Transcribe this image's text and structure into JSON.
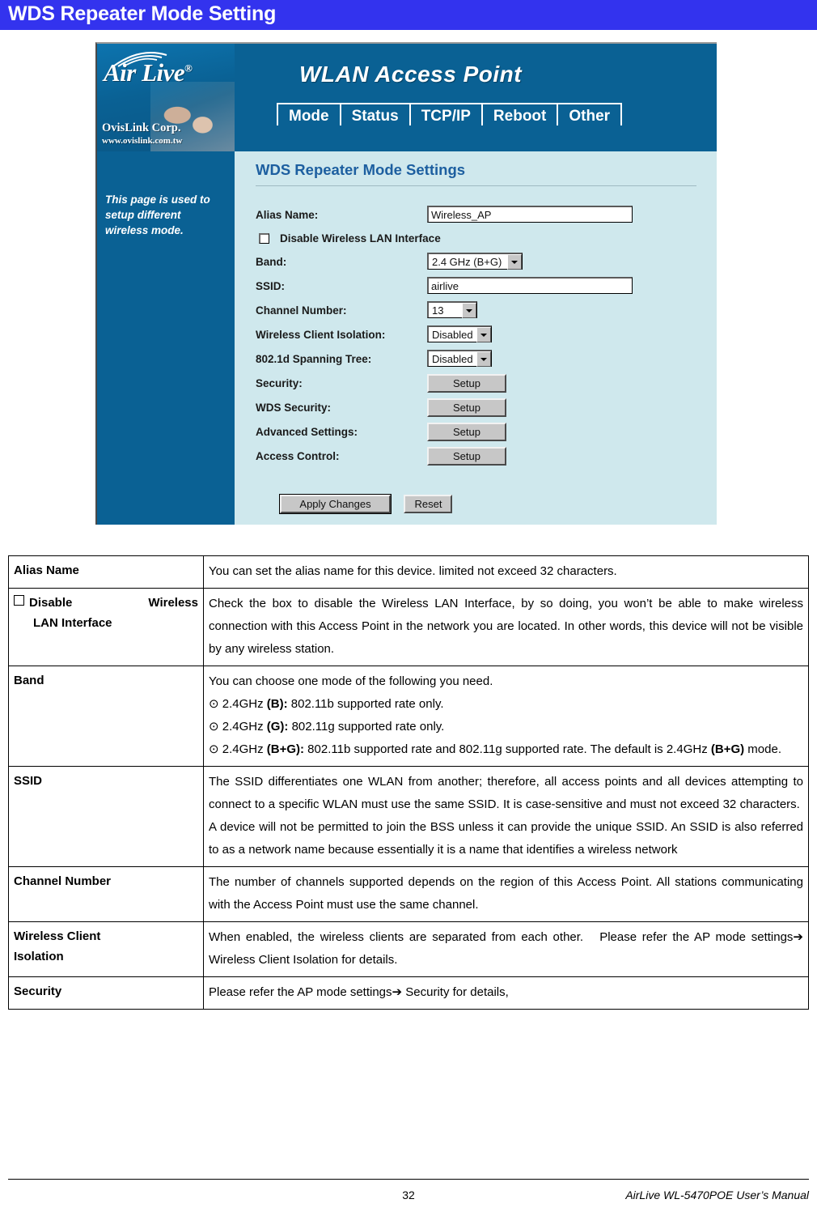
{
  "page_header": {
    "title": "WDS Repeater Mode Setting",
    "bar_color": "#3333EE"
  },
  "screenshot": {
    "banner": {
      "brand_logo": "Air Live",
      "brand_registered": "®",
      "brand_corp": "OvisLink Corp.",
      "brand_url": "www.ovislink.com.tw",
      "product_title": "WLAN Access Point",
      "banner_color": "#0A6194",
      "tabs": [
        {
          "label": "Mode"
        },
        {
          "label": "Status"
        },
        {
          "label": "TCP/IP"
        },
        {
          "label": "Reboot"
        },
        {
          "label": "Other"
        }
      ]
    },
    "sidebar": {
      "help_text": "This page is used to setup different wireless mode."
    },
    "content": {
      "title": "WDS Repeater Mode Settings",
      "title_color": "#1D5FA0",
      "background_color": "#CFE8ED",
      "fields": {
        "alias_name": {
          "label": "Alias Name:",
          "value": "Wireless_AP"
        },
        "disable_wlan": {
          "label": "Disable Wireless LAN Interface",
          "checked": false
        },
        "band": {
          "label": "Band:",
          "value": "2.4 GHz (B+G)"
        },
        "ssid": {
          "label": "SSID:",
          "value": "airlive"
        },
        "channel_number": {
          "label": "Channel Number:",
          "value": "13"
        },
        "wireless_client_isolation": {
          "label": "Wireless Client Isolation:",
          "value": "Disabled"
        },
        "spanning_tree": {
          "label": "802.1d Spanning Tree:",
          "value": "Disabled"
        },
        "security": {
          "label": "Security:",
          "button": "Setup"
        },
        "wds_security": {
          "label": "WDS Security:",
          "button": "Setup"
        },
        "advanced_settings": {
          "label": "Advanced Settings:",
          "button": "Setup"
        },
        "access_control": {
          "label": "Access Control:",
          "button": "Setup"
        }
      },
      "actions": {
        "apply": "Apply Changes",
        "reset": "Reset"
      }
    }
  },
  "description_table": {
    "rows": [
      {
        "key": "Alias Name",
        "key_style": "plain",
        "value_html": "You can set the alias name for this device. limited not exceed 32 characters."
      },
      {
        "key_line1_left": "Disable",
        "key_line1_right": "Wireless",
        "key_line2": "LAN Interface",
        "key_style": "checkbox-split",
        "value_html": "Check the box to disable the Wireless LAN Interface, by so doing, you won’t be able to make wireless connection with this Access Point in the network you are located. In other words, this device will not be visible by any wireless station."
      },
      {
        "key": "Band",
        "key_style": "plain",
        "value_html": "You can choose one mode of the following you need.<br>⊙ 2.4GHz <b>(B):</b> 802.11b supported rate only.<br>⊙ 2.4GHz <b>(G):</b> 802.11g supported rate only.<br>⊙ 2.4GHz <b>(B+G):</b> 802.11b supported rate and 802.11g supported rate. The default is 2.4GHz <b>(B+G)</b> mode."
      },
      {
        "key": "SSID",
        "key_style": "plain",
        "value_html": "The SSID differentiates one WLAN from another; therefore, all access points and all devices attempting to connect to a specific WLAN must use the same SSID. It is case-sensitive and must not exceed 32 characters.&nbsp; A device will not be permitted to join the BSS unless it can provide the unique SSID. An SSID is also referred to as a network name because essentially it is a name that identifies a wireless network"
      },
      {
        "key": "Channel Number",
        "key_style": "plain",
        "value_html": "The number of channels supported depends on the region of this Access Point. All stations communicating with the Access Point must use the same channel."
      },
      {
        "key_line1": "Wireless Client",
        "key_line2": "Isolation",
        "key_style": "two-line",
        "value_html": "When enabled, the wireless clients are separated from each other.&nbsp;&nbsp; Please refer the AP mode settings➔ Wireless Client Isolation for details."
      },
      {
        "key": "Security",
        "key_style": "plain",
        "value_html": "Please refer the AP mode settings➔ Security for details,"
      }
    ]
  },
  "footer": {
    "page_number": "32",
    "manual_text": "AirLive WL-5470POE User’s Manual"
  }
}
